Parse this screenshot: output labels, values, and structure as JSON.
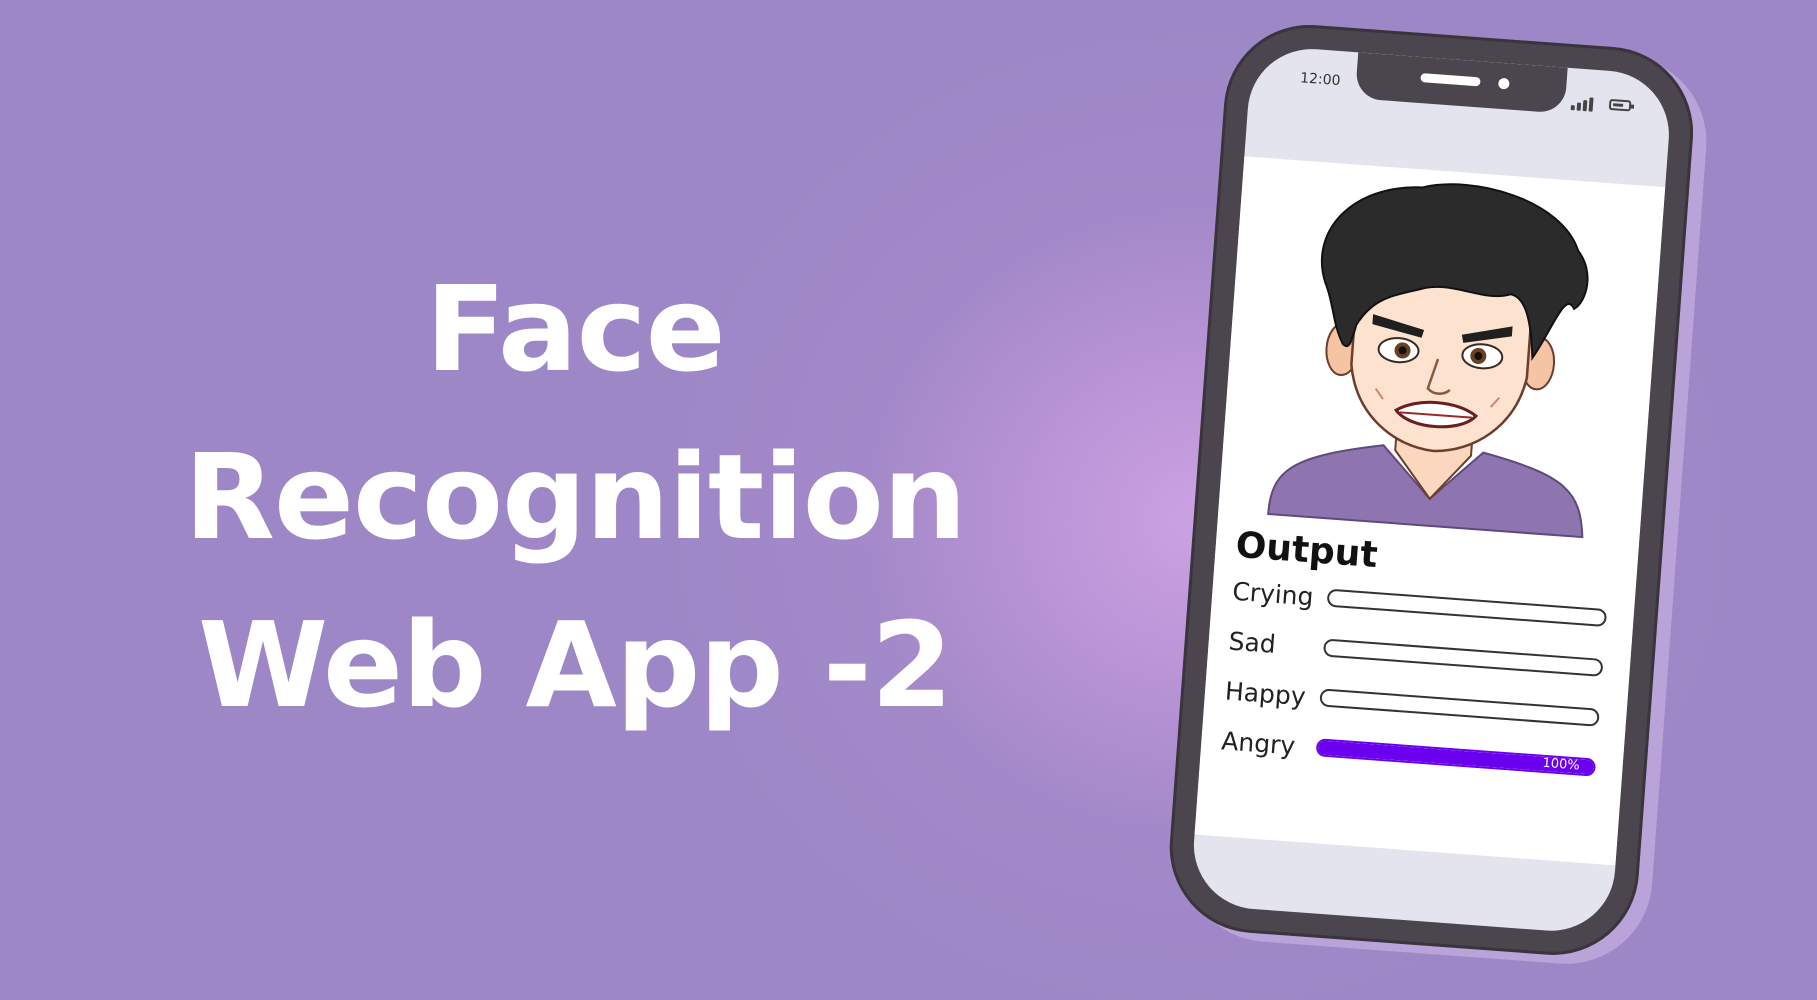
{
  "headline": {
    "line1": "Face",
    "line2": "Recognition",
    "line3": "Web App -2"
  },
  "phone": {
    "status_time": "12:00",
    "output_title": "Output",
    "emotions": [
      {
        "label": "Crying",
        "value": 0,
        "value_text": ""
      },
      {
        "label": "Sad",
        "value": 0,
        "value_text": ""
      },
      {
        "label": "Happy",
        "value": 0,
        "value_text": ""
      },
      {
        "label": "Angry",
        "value": 100,
        "value_text": "100%"
      }
    ],
    "icons": [
      "signal-icon",
      "battery-icon"
    ]
  },
  "colors": {
    "background": "#9d87c6",
    "bar_fill": "#6a00ee",
    "phone_frame": "#4b454d",
    "shirt": "#8f75b0"
  }
}
